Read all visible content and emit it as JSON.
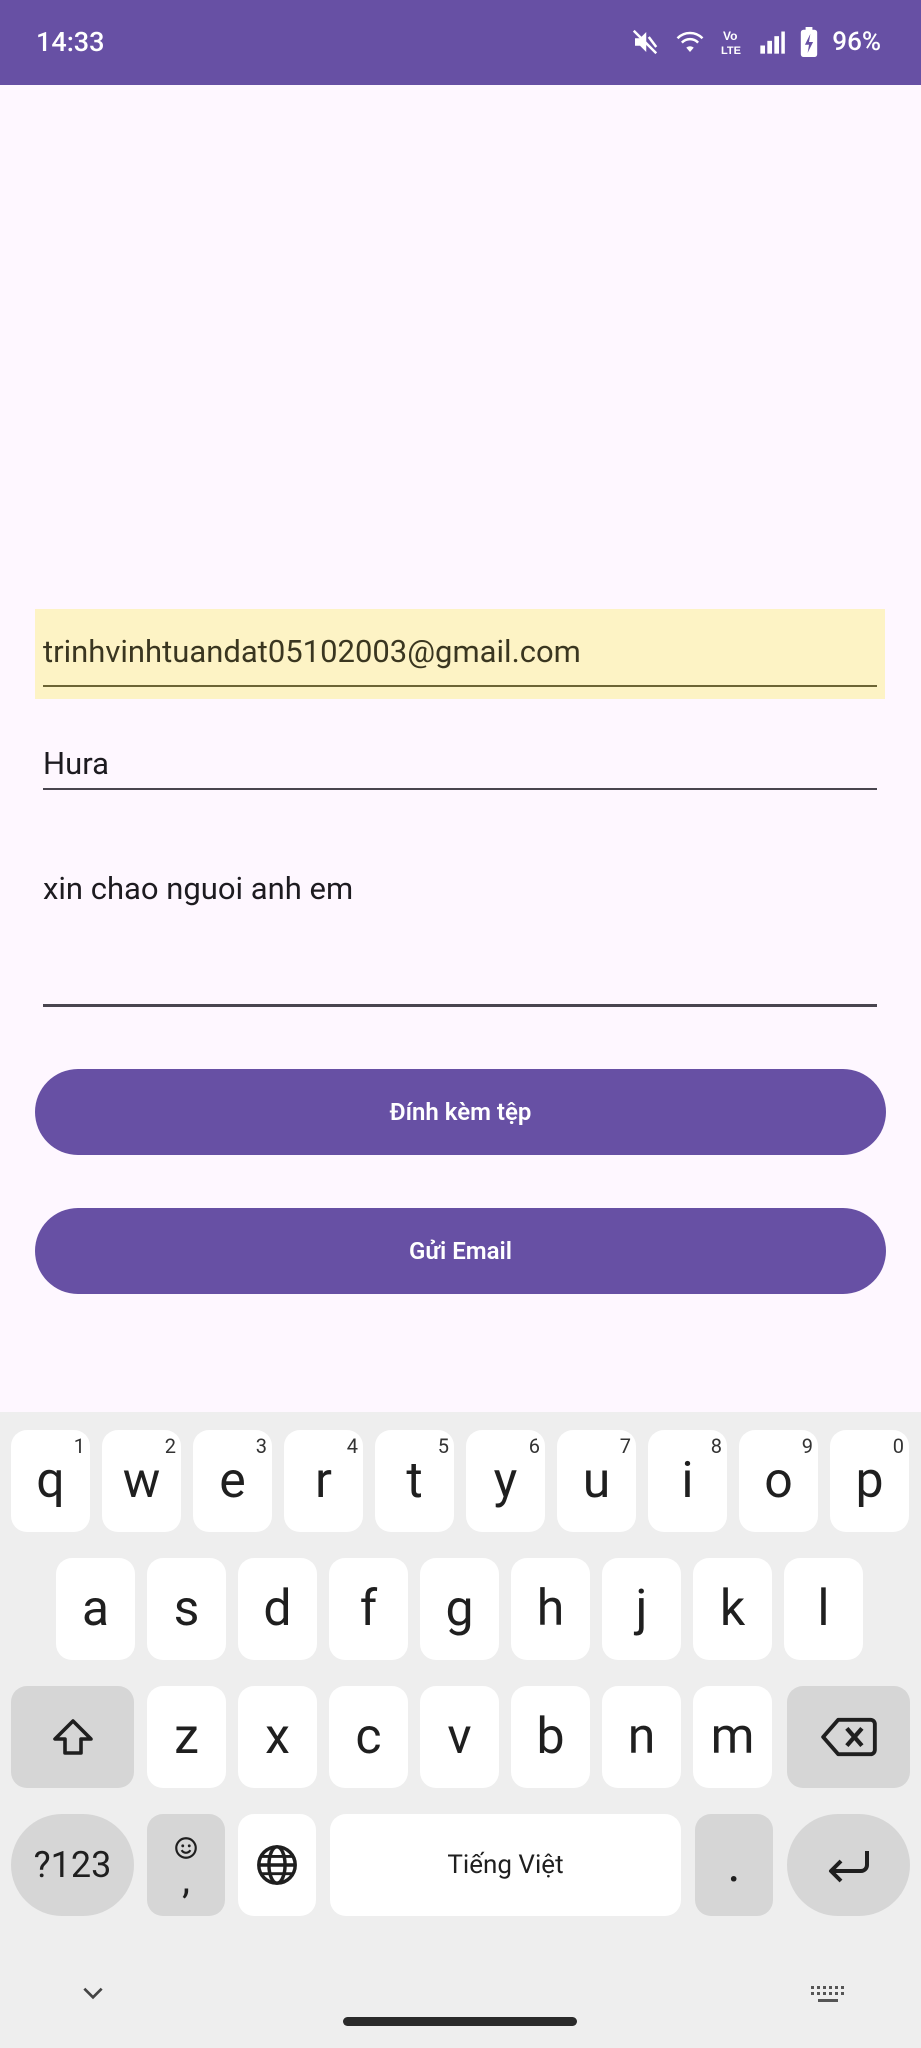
{
  "status_bar": {
    "time": "14:33",
    "battery_percent": "96%",
    "network_label": "Vo LTE",
    "icons": [
      "mute-icon",
      "wifi-icon",
      "volte-icon",
      "signal-icon",
      "battery-icon"
    ]
  },
  "form": {
    "to_value": "trinhvinhtuandat05102003@gmail.com",
    "subject_value": "Hura",
    "body_value": "xin chao nguoi anh em"
  },
  "buttons": {
    "attach_label": "Đính kèm tệp",
    "send_label": "Gửi Email"
  },
  "keyboard": {
    "row1": [
      {
        "k": "q",
        "h": "1"
      },
      {
        "k": "w",
        "h": "2"
      },
      {
        "k": "e",
        "h": "3"
      },
      {
        "k": "r",
        "h": "4"
      },
      {
        "k": "t",
        "h": "5"
      },
      {
        "k": "y",
        "h": "6"
      },
      {
        "k": "u",
        "h": "7"
      },
      {
        "k": "i",
        "h": "8"
      },
      {
        "k": "o",
        "h": "9"
      },
      {
        "k": "p",
        "h": "0"
      }
    ],
    "row2": [
      "a",
      "s",
      "d",
      "f",
      "g",
      "h",
      "j",
      "k",
      "l"
    ],
    "row3": [
      "z",
      "x",
      "c",
      "v",
      "b",
      "n",
      "m"
    ],
    "symbols_label": "?123",
    "comma_label": ",",
    "space_label": "Tiếng Việt",
    "period_label": "."
  },
  "colors": {
    "primary": "#6750a4",
    "background": "#fef7ff",
    "autofill_highlight": "#fdf3c5",
    "keyboard_bg": "#eeeeee"
  }
}
